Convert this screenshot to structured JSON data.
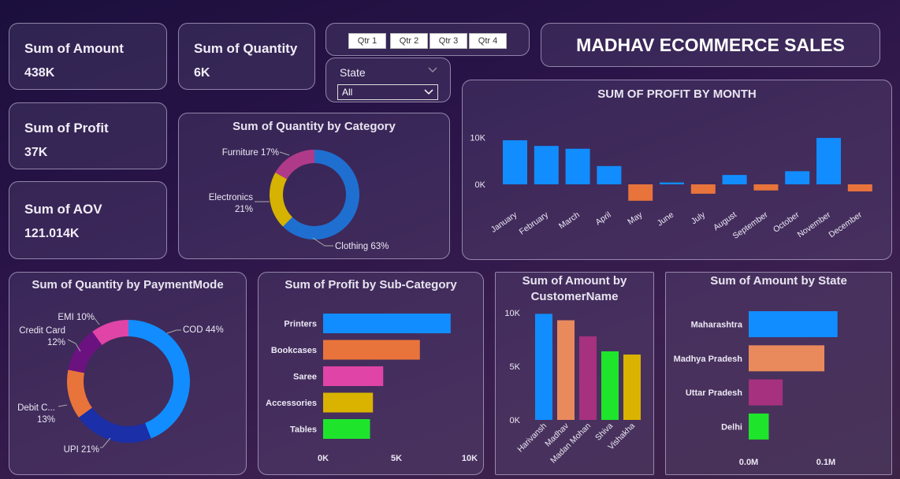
{
  "kpis": {
    "amount": {
      "label": "Sum of Amount",
      "value": "438K"
    },
    "quantity": {
      "label": "Sum of Quantity",
      "value": "6K"
    },
    "profit": {
      "label": "Sum of Profit",
      "value": "37K"
    },
    "aov": {
      "label": "Sum of AOV",
      "value": "121.014K"
    }
  },
  "quarter_slicer": {
    "buttons": [
      "Qtr 1",
      "Qtr 2",
      "Qtr 3",
      "Qtr 4"
    ]
  },
  "state_slicer": {
    "label": "State",
    "selected": "All"
  },
  "header": {
    "title": "MADHAV ECOMMERCE SALES"
  },
  "chart_data": [
    {
      "id": "profit_by_month",
      "type": "bar",
      "title": "SUM OF PROFIT BY MONTH",
      "categories": [
        "January",
        "February",
        "March",
        "April",
        "May",
        "June",
        "July",
        "August",
        "September",
        "October",
        "November",
        "December"
      ],
      "values": [
        9400,
        8200,
        7600,
        3900,
        -3500,
        400,
        -2000,
        2000,
        -1300,
        2800,
        9900,
        -1500
      ],
      "y_ticks": [
        {
          "value": 10000,
          "label": "10K"
        },
        {
          "value": 0,
          "label": "0K"
        }
      ],
      "positive_color": "#118dff",
      "negative_color": "#e8743b"
    },
    {
      "id": "quantity_by_category",
      "type": "pie",
      "donut": true,
      "title": "Sum of Quantity by Category",
      "slices": [
        {
          "name": "Clothing",
          "label": "Clothing 63%",
          "value": 63,
          "color": "#1f6fd1"
        },
        {
          "name": "Electronics",
          "label_lines": [
            "Electronics",
            "21%"
          ],
          "value": 21,
          "color": "#d6b300"
        },
        {
          "name": "Furniture",
          "label": "Furniture 17%",
          "value": 17,
          "color": "#b03a8a"
        }
      ]
    },
    {
      "id": "quantity_by_paymentmode",
      "type": "pie",
      "donut": true,
      "title": "Sum of Quantity by PaymentMode",
      "slices": [
        {
          "name": "COD",
          "label_lines": [
            "COD 44%"
          ],
          "value": 44,
          "color": "#118dff"
        },
        {
          "name": "UPI",
          "label_lines": [
            "UPI 21%"
          ],
          "value": 21,
          "color": "#1a2fa8"
        },
        {
          "name": "Debit C...",
          "label_lines": [
            "Debit C...",
            "13%"
          ],
          "value": 13,
          "color": "#e8743b"
        },
        {
          "name": "Credit Card",
          "label_lines": [
            "Credit Card",
            "12%"
          ],
          "value": 12,
          "color": "#6b1280"
        },
        {
          "name": "EMI",
          "label_lines": [
            "EMI 10%"
          ],
          "value": 10,
          "color": "#e044a7"
        }
      ]
    },
    {
      "id": "profit_by_subcategory",
      "type": "bar",
      "orientation": "horizontal",
      "title": "Sum of Profit by Sub-Category",
      "categories": [
        "Printers",
        "Bookcases",
        "Saree",
        "Accessories",
        "Tables"
      ],
      "values": [
        8700,
        6600,
        4100,
        3400,
        3200
      ],
      "colors": [
        "#118dff",
        "#e8743b",
        "#e044a7",
        "#d9b300",
        "#1ee52c"
      ],
      "x_ticks": [
        {
          "value": 0,
          "label": "0K"
        },
        {
          "value": 5000,
          "label": "5K"
        },
        {
          "value": 10000,
          "label": "10K"
        }
      ]
    },
    {
      "id": "amount_by_customer",
      "type": "bar",
      "title": "Sum of Amount by CustomerName",
      "title_lines": [
        "Sum of Amount by",
        "CustomerName"
      ],
      "categories": [
        "Harivansh",
        "Madhav",
        "Madan Mohan",
        "Shiva",
        "Vishakha"
      ],
      "values": [
        9900,
        9300,
        7800,
        6400,
        6100
      ],
      "colors": [
        "#118dff",
        "#e98a5d",
        "#a6317e",
        "#1ee52c",
        "#d9b300"
      ],
      "y_ticks": [
        {
          "value": 10000,
          "label": "10K"
        },
        {
          "value": 5000,
          "label": "5K"
        },
        {
          "value": 0,
          "label": "0K"
        }
      ]
    },
    {
      "id": "amount_by_state",
      "type": "bar",
      "orientation": "horizontal",
      "title": "Sum of Amount by State",
      "categories": [
        "Maharashtra",
        "Madhya Pradesh",
        "Uttar Pradesh",
        "Delhi"
      ],
      "values": [
        0.115,
        0.098,
        0.044,
        0.026
      ],
      "colors": [
        "#118dff",
        "#e98a5d",
        "#a6317e",
        "#1ee52c"
      ],
      "x_ticks": [
        {
          "value": 0,
          "label": "0.0M"
        },
        {
          "value": 0.1,
          "label": "0.1M"
        }
      ]
    }
  ]
}
